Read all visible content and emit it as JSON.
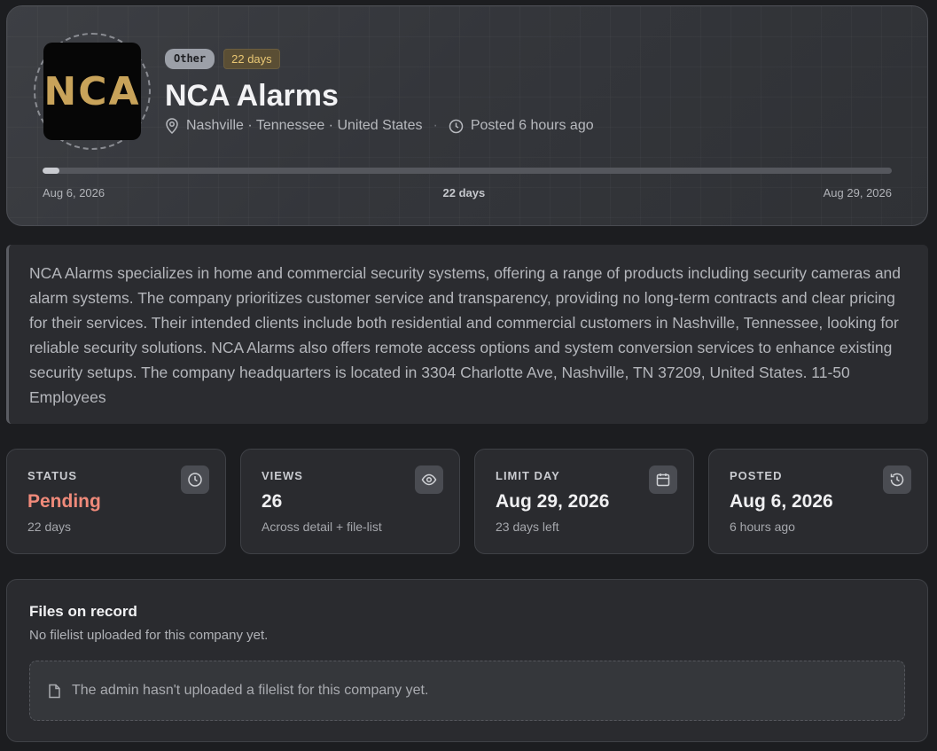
{
  "company": {
    "logo_text": "NCA",
    "category_chip": "Other",
    "days_chip": "22 days",
    "name": "NCA Alarms",
    "location": "Nashville · Tennessee · United States",
    "posted_relative": "Posted 6 hours ago"
  },
  "timeline": {
    "start_label": "Aug 6, 2026",
    "middle_label": "22 days",
    "end_label": "Aug 29, 2026",
    "progress_fraction": 0.02
  },
  "description": "NCA Alarms specializes in home and commercial security systems, offering a range of products including security cameras and alarm systems. The company prioritizes customer service and transparency, providing no long-term contracts and clear pricing for their services. Their intended clients include both residential and commercial customers in Nashville, Tennessee, looking for reliable security solutions. NCA Alarms also offers remote access options and system conversion services to enhance existing security setups. The company headquarters is located in 3304 Charlotte Ave, Nashville, TN 37209, United States. 11-50 Employees",
  "stats": [
    {
      "label": "STATUS",
      "value": "Pending",
      "sub": "22 days",
      "icon": "clock-icon"
    },
    {
      "label": "VIEWS",
      "value": "26",
      "sub": "Across detail + file-list",
      "icon": "eye-icon"
    },
    {
      "label": "LIMIT DAY",
      "value": "Aug 29, 2026",
      "sub": "23 days left",
      "icon": "calendar-icon"
    },
    {
      "label": "POSTED",
      "value": "Aug 6, 2026",
      "sub": "6 hours ago",
      "icon": "history-icon"
    }
  ],
  "files": {
    "title": "Files on record",
    "subtitle": "No filelist uploaded for this company yet.",
    "empty_message": "The admin hasn't uploaded a filelist for this company yet."
  },
  "colors": {
    "pending": "#f08a7a",
    "days_chip_text": "#e9c774",
    "logo_gold": "#c8a35a"
  }
}
